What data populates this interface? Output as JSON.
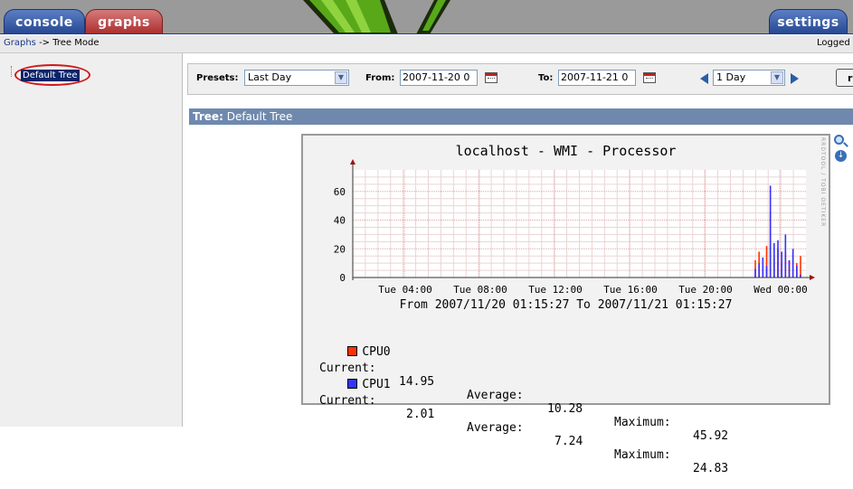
{
  "tabs": {
    "console": "console",
    "graphs": "graphs",
    "settings": "settings"
  },
  "breadcrumb": {
    "link": "Graphs",
    "rest": "-> Tree Mode"
  },
  "logged_in_text": "Logged",
  "tree": {
    "node_label": "Default Tree"
  },
  "presets": {
    "presets_label": "Presets:",
    "preset_value": "Last Day",
    "from_label": "From:",
    "from_value": "2007-11-20 0",
    "to_label": "To:",
    "to_value": "2007-11-21 0",
    "timespan_value": "1 Day",
    "refresh_label": "r"
  },
  "tree_header": {
    "prefix": "Tree:",
    "name": "Default Tree"
  },
  "graph": {
    "title": "localhost - WMI - Processor",
    "side_text": "RRDTOOL / TOBI OETIKER",
    "range_text": "From 2007/11/20 01:15:27 To 2007/11/21 01:15:27",
    "series": [
      {
        "name": "CPU0",
        "color": "#ff3300",
        "current_label": "Current:",
        "current": "14.95",
        "average_label": "Average:",
        "average": "10.28",
        "maximum_label": "Maximum:",
        "maximum": "45.92"
      },
      {
        "name": "CPU1",
        "color": "#3333ff",
        "current_label": "Current:",
        "current": "2.01",
        "average_label": "Average:",
        "average": "7.24",
        "maximum_label": "Maximum:",
        "maximum": "24.83"
      }
    ]
  },
  "chart_data": {
    "type": "area",
    "title": "localhost - WMI - Processor",
    "ylim": [
      0,
      75
    ],
    "yticks": [
      0,
      20,
      40,
      60
    ],
    "xticks": [
      "Tue 04:00",
      "Tue 08:00",
      "Tue 12:00",
      "Tue 16:00",
      "Tue 20:00",
      "Wed 00:00"
    ],
    "x": [
      "Tue 22:48",
      "Tue 23:00",
      "Tue 23:12",
      "Tue 23:24",
      "Tue 23:36",
      "Tue 23:48",
      "Wed 00:00",
      "Wed 00:12",
      "Wed 00:24",
      "Wed 00:36",
      "Wed 00:48",
      "Wed 01:00",
      "Wed 01:12"
    ],
    "series": [
      {
        "name": "CPU0",
        "color": "#ff3300",
        "values": [
          12,
          18,
          8,
          22,
          46,
          14,
          20,
          10,
          18,
          12,
          16,
          10,
          15
        ]
      },
      {
        "name": "CPU1",
        "color": "#3333ff",
        "values": [
          6,
          10,
          14,
          8,
          64,
          24,
          26,
          18,
          30,
          12,
          20,
          8,
          2
        ]
      }
    ]
  }
}
